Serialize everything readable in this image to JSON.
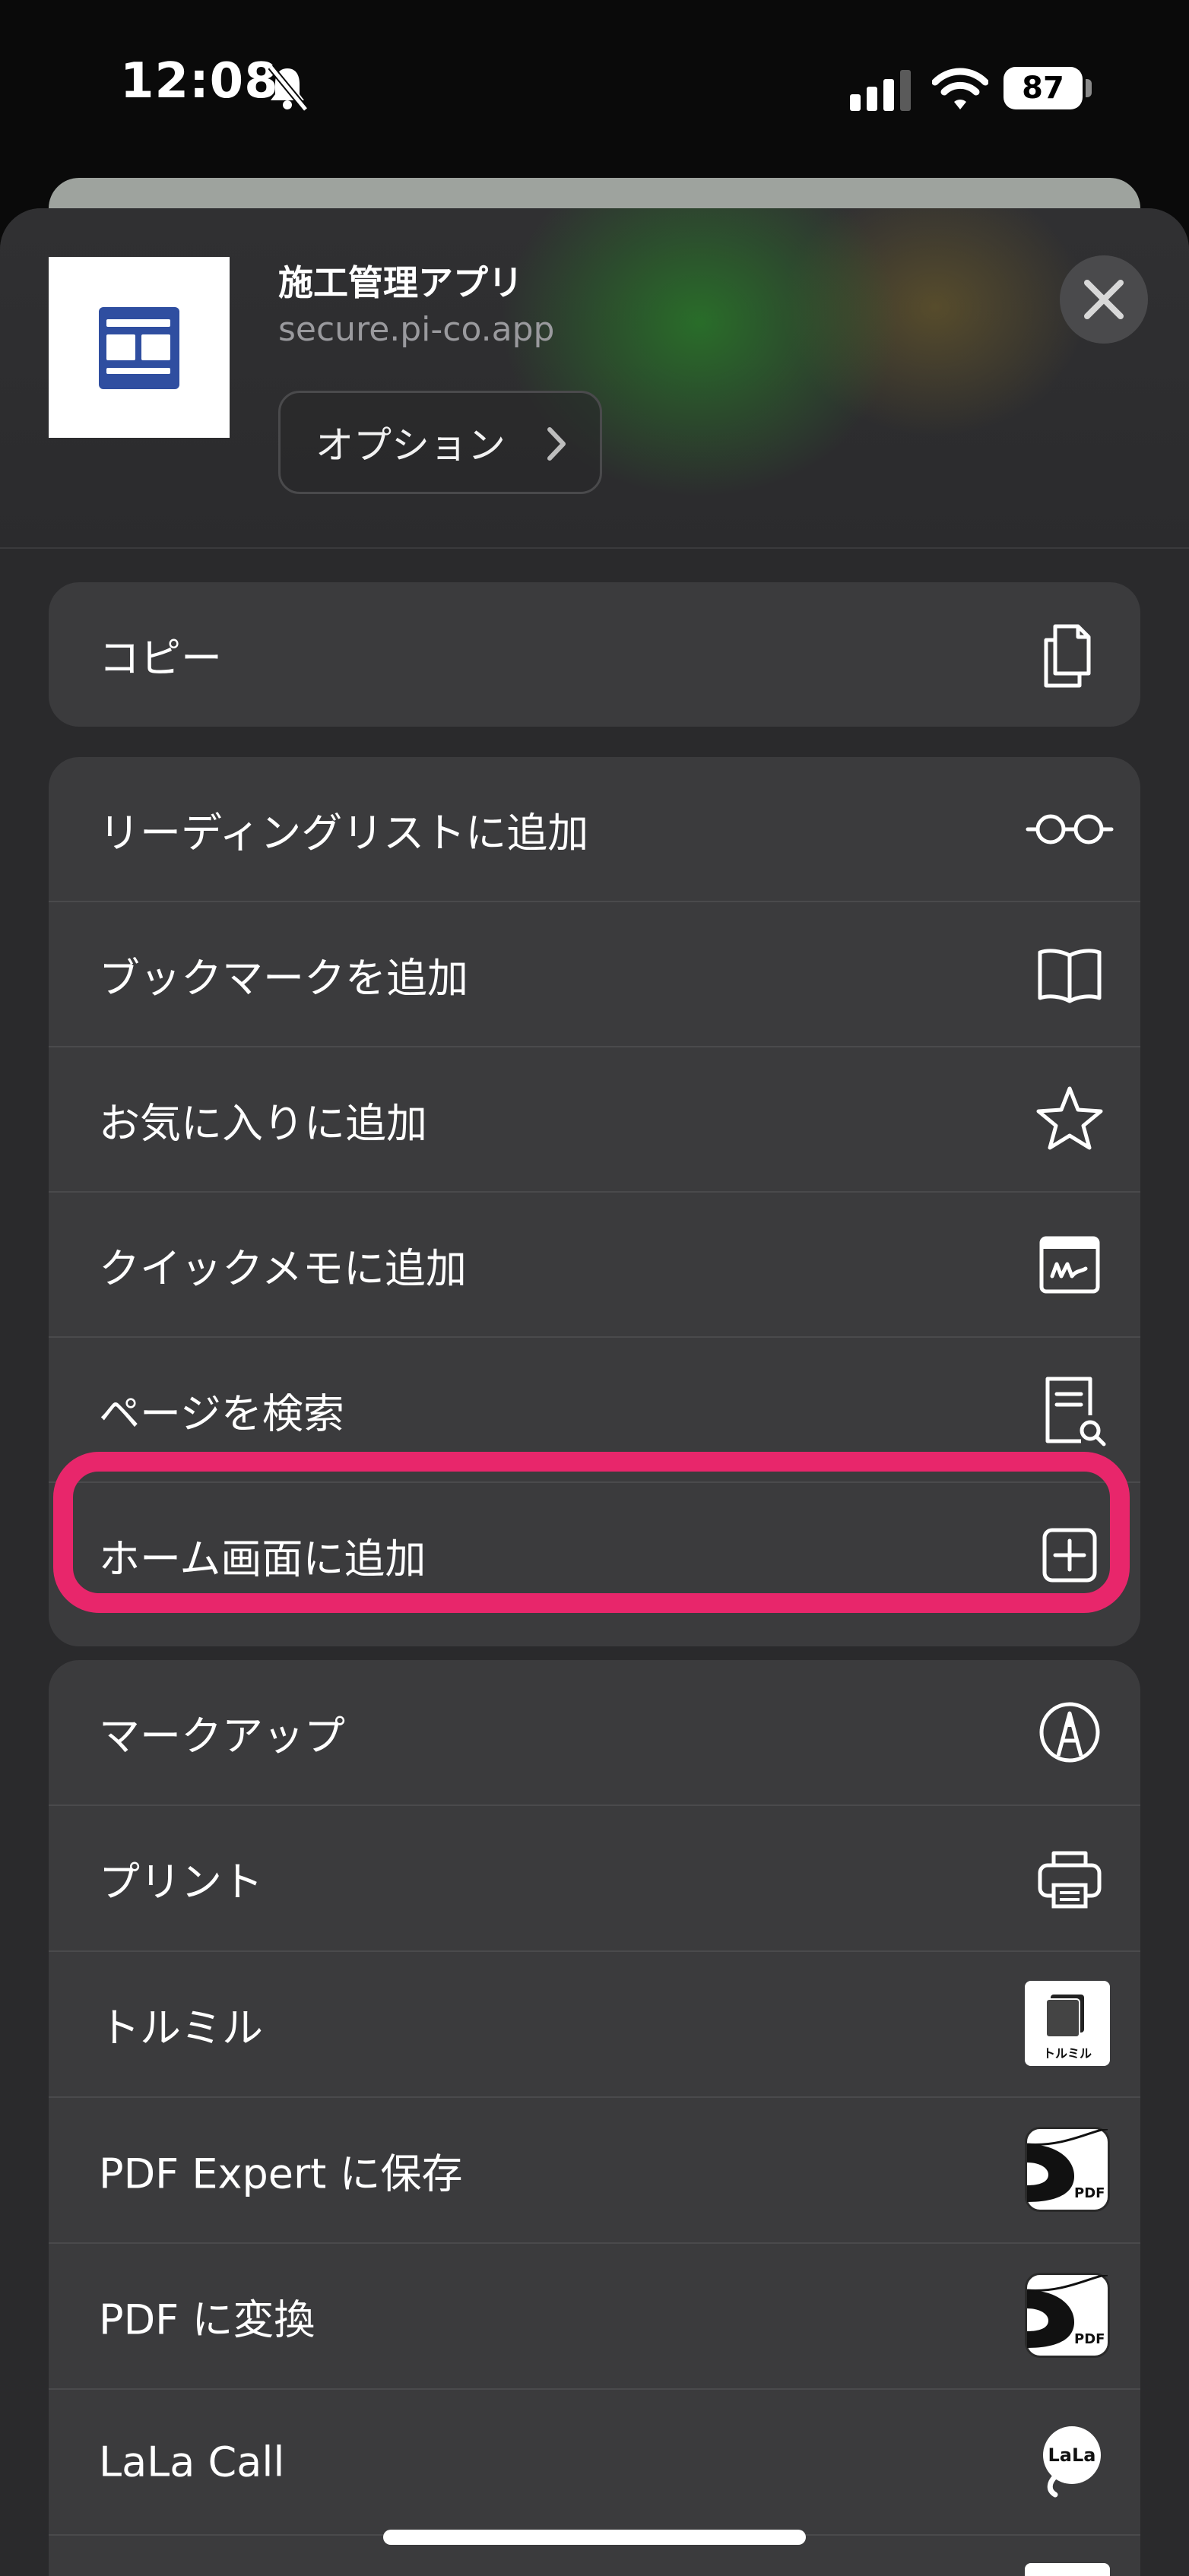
{
  "status_bar": {
    "time": "12:08",
    "battery": "87",
    "icons": [
      "silent-bell-icon",
      "cellular-signal-icon",
      "wifi-icon",
      "battery-icon"
    ]
  },
  "share_header": {
    "app_title": "施工管理アプリ",
    "url": "secure.pi-co.app",
    "options_label": "オプション",
    "close_icon": "close-icon"
  },
  "actions": {
    "copy": {
      "label": "コピー",
      "icon": "copy-icon"
    },
    "reading_list": {
      "label": "リーディングリストに追加",
      "icon": "glasses-icon"
    },
    "bookmark": {
      "label": "ブックマークを追加",
      "icon": "book-icon"
    },
    "favorites": {
      "label": "お気に入りに追加",
      "icon": "star-icon"
    },
    "quick_note": {
      "label": "クイックメモに追加",
      "icon": "quick-note-icon"
    },
    "find_on_page": {
      "label": "ページを検索",
      "icon": "doc-search-icon"
    },
    "add_home": {
      "label": "ホーム画面に追加",
      "icon": "plus-square-icon"
    },
    "markup": {
      "label": "マークアップ",
      "icon": "markup-icon"
    },
    "print": {
      "label": "プリント",
      "icon": "printer-icon"
    },
    "torumiru": {
      "label": "トルミル",
      "icon": "torumiru-app-icon",
      "icon_text": "トルミル"
    },
    "pdf_expert": {
      "label": "PDF Expert に保存",
      "icon": "pdf-expert-icon",
      "icon_text": "PDF"
    },
    "pdf_convert": {
      "label": "PDF に変換",
      "icon": "pdf-convert-icon",
      "icon_text": "PDF"
    },
    "lala_call": {
      "label": "LaLa Call",
      "icon": "lala-call-icon",
      "icon_text": "LaLa"
    }
  },
  "colors": {
    "highlight": "#e8266b",
    "sheet_bg": "#2a2a2c",
    "row_bg": "#3b3b3d"
  }
}
